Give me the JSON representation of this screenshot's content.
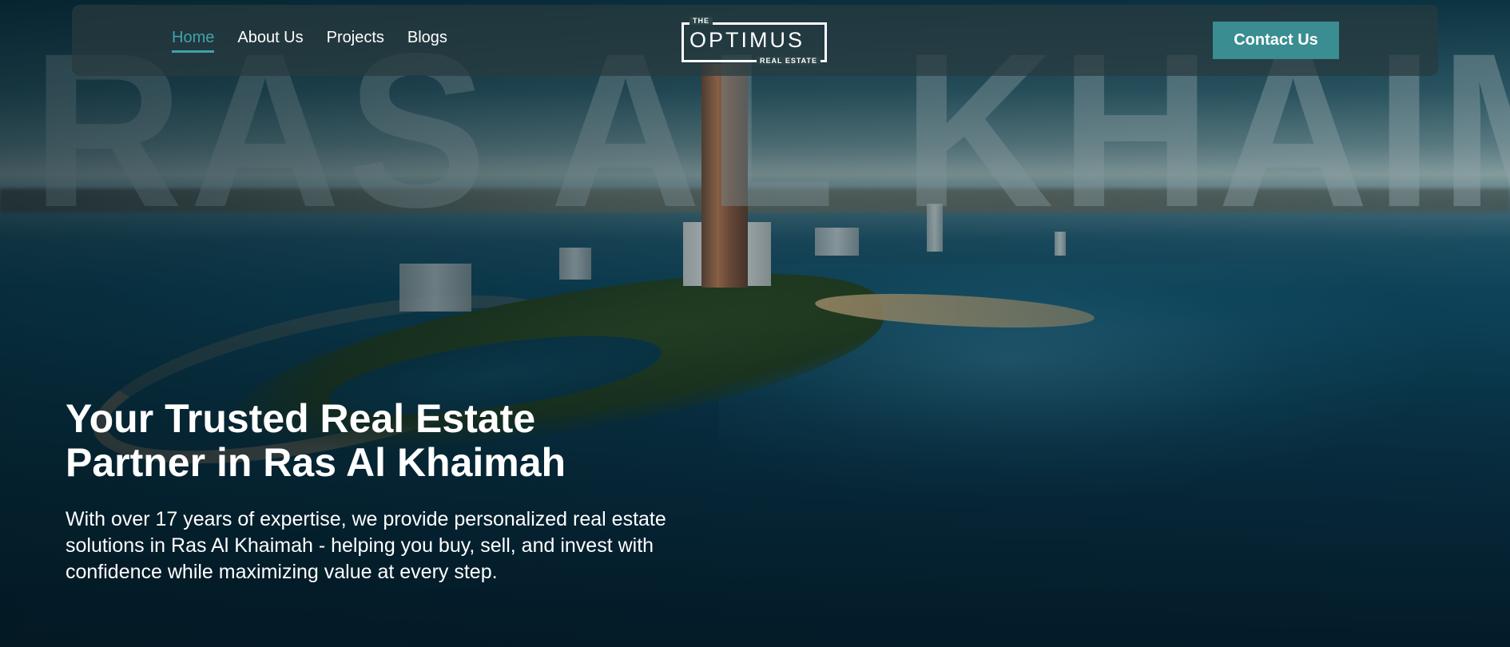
{
  "background": {
    "watermark_text": "RAS AL KHAIMA",
    "image": "ras-al-khaimah-aerial-island"
  },
  "nav": {
    "links": [
      {
        "label": "Home",
        "active": true
      },
      {
        "label": "About Us",
        "active": false
      },
      {
        "label": "Projects",
        "active": false
      },
      {
        "label": "Blogs",
        "active": false
      }
    ],
    "contact_label": "Contact Us"
  },
  "logo": {
    "the": "THE",
    "name": "OPTIMUS",
    "sub": "REAL ESTATE"
  },
  "hero": {
    "title": "Your Trusted Real Estate Partner in Ras Al Khaimah",
    "description": "With over 17 years of expertise, we provide personalized real estate solutions in Ras Al Khaimah - helping you buy, sell, and invest with confidence while maximizing value at every step."
  },
  "colors": {
    "accent": "#3fa3a9",
    "button": "#3a8d90",
    "nav_bg": "#2c4347"
  }
}
